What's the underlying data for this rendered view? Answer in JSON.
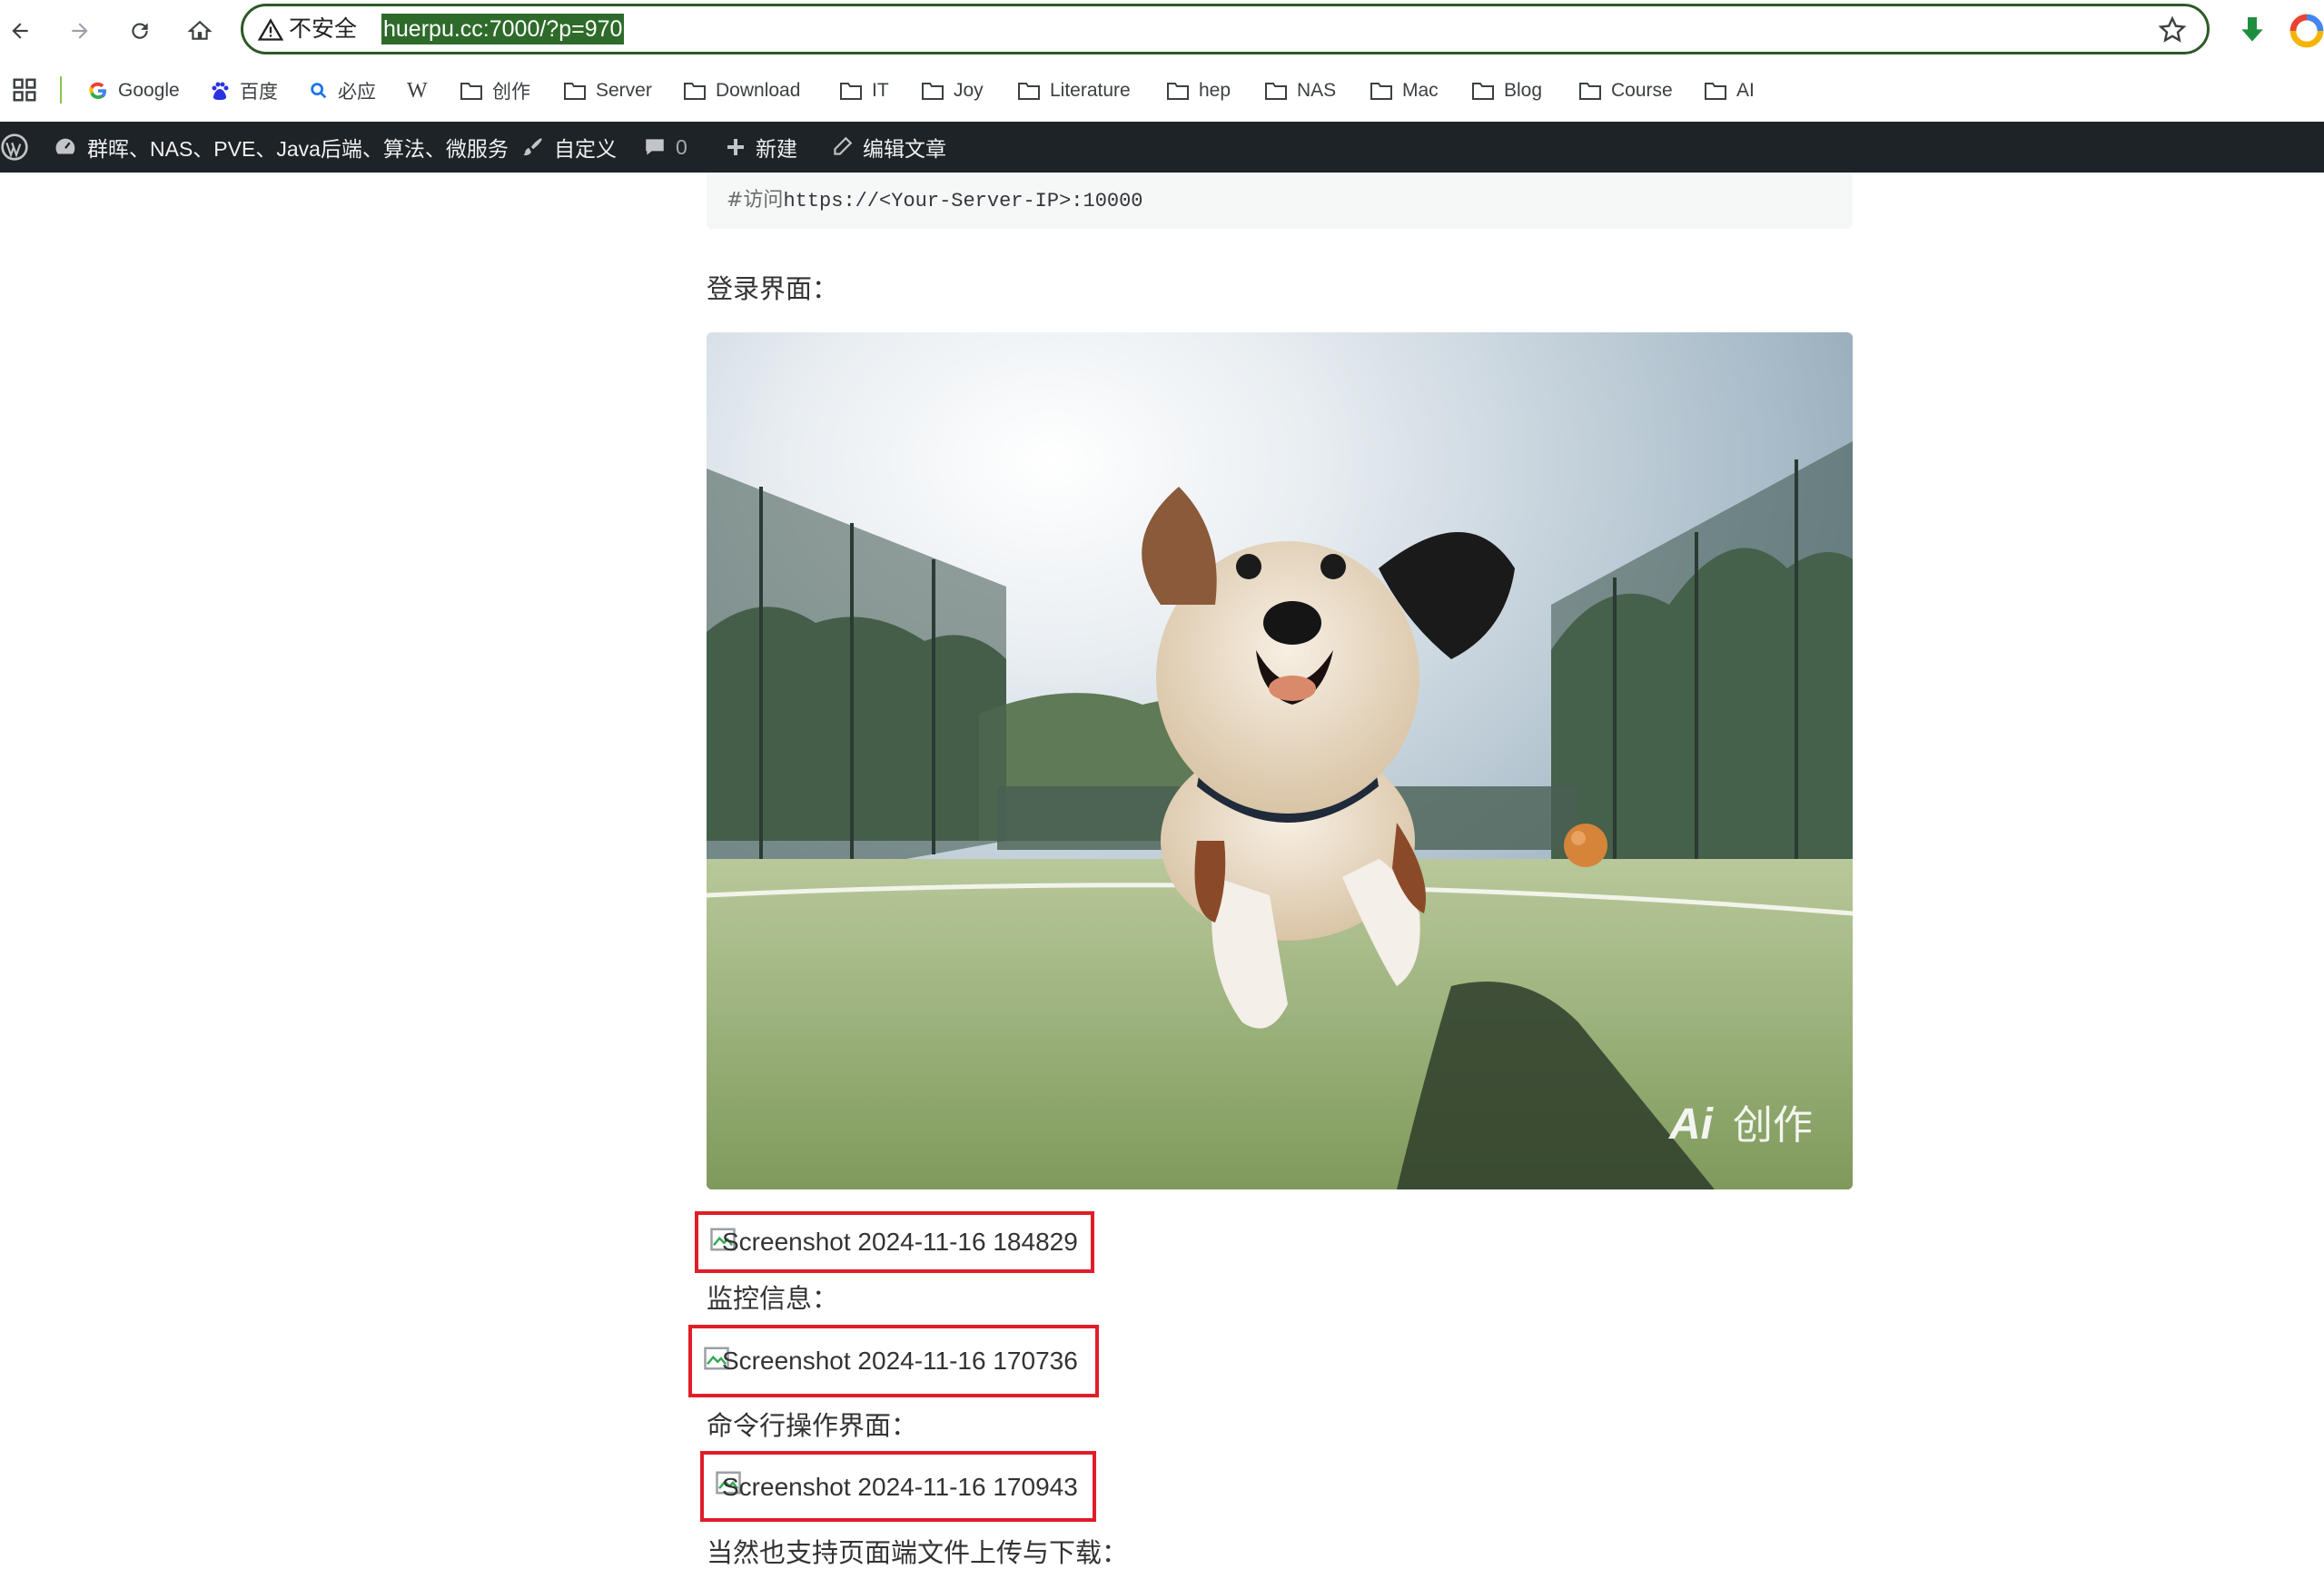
{
  "browser": {
    "security_label": "不安全",
    "url": "huerpu.cc:7000/?p=970"
  },
  "bookmarks": [
    {
      "label": "Google",
      "icon": "google-icon"
    },
    {
      "label": "百度",
      "icon": "baidu-icon"
    },
    {
      "label": "必应",
      "icon": "bing-search-icon"
    },
    {
      "label": "W",
      "icon": "wikipedia-icon"
    },
    {
      "label": "创作",
      "icon": "folder-icon"
    },
    {
      "label": "Server",
      "icon": "folder-icon"
    },
    {
      "label": "Download",
      "icon": "folder-icon"
    },
    {
      "label": "IT",
      "icon": "folder-icon"
    },
    {
      "label": "Joy",
      "icon": "folder-icon"
    },
    {
      "label": "Literature",
      "icon": "folder-icon"
    },
    {
      "label": "hep",
      "icon": "folder-icon"
    },
    {
      "label": "NAS",
      "icon": "folder-icon"
    },
    {
      "label": "Mac",
      "icon": "folder-icon"
    },
    {
      "label": "Blog",
      "icon": "folder-icon"
    },
    {
      "label": "Course",
      "icon": "folder-icon"
    },
    {
      "label": "AI",
      "icon": "folder-icon"
    }
  ],
  "adminbar": {
    "site_title": "群晖、NAS、PVE、Java后端、算法、微服务",
    "customize": "自定义",
    "comments_count": "0",
    "new": "新建",
    "edit_post": "编辑文章"
  },
  "content": {
    "code_comment": "#访问",
    "code_url": "https://<Your-Server-IP>:10000",
    "login_caption": "登录界面：",
    "hero_watermark_ai": "Ai",
    "hero_watermark_text": "创作",
    "broken_images": [
      {
        "alt": "Screenshot 2024-11-16 184829"
      },
      {
        "alt": "Screenshot 2024-11-16 170736"
      },
      {
        "alt": "Screenshot 2024-11-16 170943"
      }
    ],
    "monitor_caption": "监控信息：",
    "cli_caption": "命令行操作界面：",
    "upload_caption": "当然也支持页面端文件上传与下载："
  },
  "colors": {
    "omnibox_border": "#2d5a27",
    "url_highlight": "#2e6b2a",
    "adminbar_bg": "#1d2327",
    "highlight_box": "#e01e28"
  }
}
